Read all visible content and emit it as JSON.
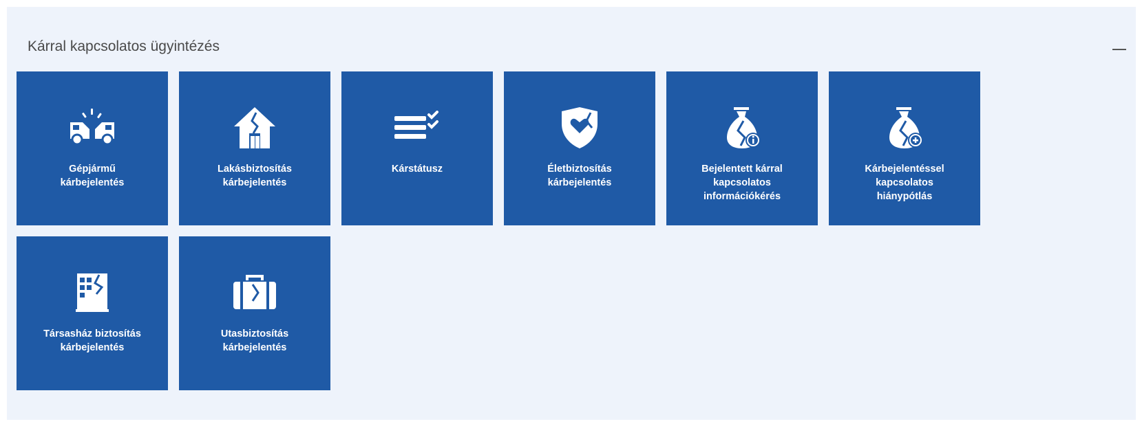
{
  "panel": {
    "title": "Kárral kapcsolatos ügyintézés",
    "collapse_symbol": "—"
  },
  "tiles": [
    {
      "label": "Gépjármű\nkárbejelentés",
      "icon": "car-crash-icon"
    },
    {
      "label": "Lakásbiztosítás\nkárbejelentés",
      "icon": "broken-house-icon"
    },
    {
      "label": "Kárstátusz",
      "icon": "checklist-icon"
    },
    {
      "label": "Életbiztosítás\nkárbejelentés",
      "icon": "heart-shield-icon"
    },
    {
      "label": "Bejelentett kárral\nkapcsolatos\ninformációkérés",
      "icon": "money-bag-info-icon"
    },
    {
      "label": "Kárbejelentéssel\nkapcsolatos\nhiánypótlás",
      "icon": "money-bag-plus-icon"
    },
    {
      "label": "Társasház biztosítás\nkárbejelentés",
      "icon": "broken-building-icon"
    },
    {
      "label": "Utasbiztosítás\nkárbejelentés",
      "icon": "broken-suitcase-icon"
    }
  ],
  "colors": {
    "tile_background": "#1f5aa6",
    "panel_background": "#eef3fb",
    "tile_text": "#ffffff"
  }
}
